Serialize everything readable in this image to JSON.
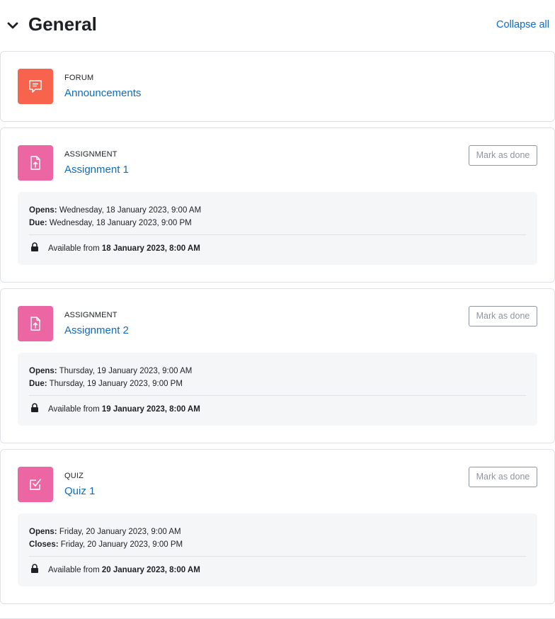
{
  "section": {
    "title": "General",
    "collapse_all": "Collapse all"
  },
  "activities": [
    {
      "type": "FORUM",
      "name": "Announcements",
      "icon": "forum-icon",
      "color": "#f7634d"
    },
    {
      "type": "ASSIGNMENT",
      "name": "Assignment 1",
      "icon": "assignment-icon",
      "color": "#eb66a2",
      "mark_done": "Mark as done",
      "dates": [
        {
          "label": "Opens:",
          "value": "Wednesday, 18 January 2023, 9:00 AM"
        },
        {
          "label": "Due:",
          "value": "Wednesday, 18 January 2023, 9:00 PM"
        }
      ],
      "availability": {
        "prefix": "Available from",
        "date": "18 January 2023, 8:00 AM"
      }
    },
    {
      "type": "ASSIGNMENT",
      "name": "Assignment 2",
      "icon": "assignment-icon",
      "color": "#eb66a2",
      "mark_done": "Mark as done",
      "dates": [
        {
          "label": "Opens:",
          "value": "Thursday, 19 January 2023, 9:00 AM"
        },
        {
          "label": "Due:",
          "value": "Thursday, 19 January 2023, 9:00 PM"
        }
      ],
      "availability": {
        "prefix": "Available from",
        "date": "19 January 2023, 8:00 AM"
      }
    },
    {
      "type": "QUIZ",
      "name": "Quiz 1",
      "icon": "quiz-icon",
      "color": "#eb66a2",
      "mark_done": "Mark as done",
      "dates": [
        {
          "label": "Opens:",
          "value": "Friday, 20 January 2023, 9:00 AM"
        },
        {
          "label": "Closes:",
          "value": "Friday, 20 January 2023, 9:00 PM"
        }
      ],
      "availability": {
        "prefix": "Available from",
        "date": "20 January 2023, 8:00 AM"
      }
    }
  ]
}
